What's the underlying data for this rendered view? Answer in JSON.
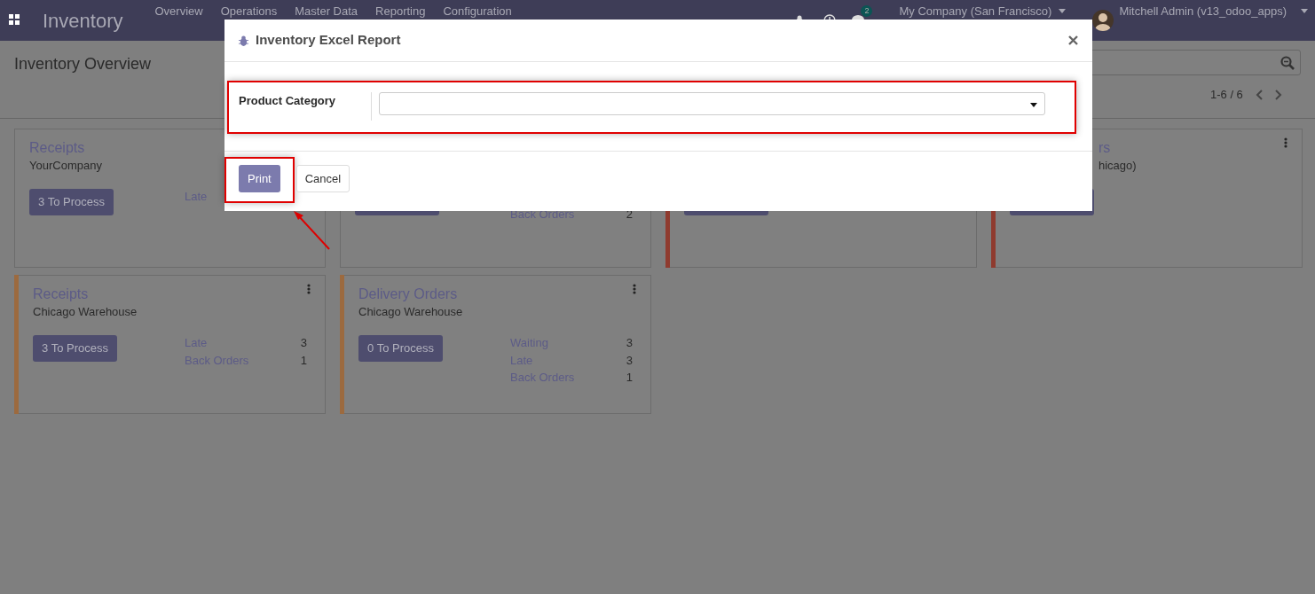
{
  "navbar": {
    "app_title": "Inventory",
    "menu": [
      {
        "label": "Overview"
      },
      {
        "label": "Operations"
      },
      {
        "label": "Master Data"
      },
      {
        "label": "Reporting"
      },
      {
        "label": "Configuration"
      }
    ],
    "message_count": "2",
    "company": "My Company (San Francisco)",
    "user": "Mitchell Admin (v13_odoo_apps)"
  },
  "control_panel": {
    "breadcrumb": "Inventory Overview",
    "pager": "1-6 / 6"
  },
  "cards": [
    {
      "title": "Receipts",
      "subtitle": "YourCompany",
      "button": "3 To Process",
      "stats": [
        {
          "label": "Late"
        }
      ]
    },
    {
      "stats": [
        {
          "label": "Back Orders",
          "count": "2"
        }
      ]
    },
    {
      "color": "#8f3b2f"
    },
    {
      "title": "rs",
      "subtitle": "hicago)",
      "menu": true,
      "color": "#8f3b2f"
    },
    {
      "title": "Receipts",
      "subtitle": "Chicago Warehouse",
      "button": "3 To Process",
      "menu": true,
      "color": "#9c6a3f",
      "stats": [
        {
          "label": "Late",
          "count": "3"
        },
        {
          "label": "Back Orders",
          "count": "1"
        }
      ]
    },
    {
      "title": "Delivery Orders",
      "subtitle": "Chicago Warehouse",
      "button": "0 To Process",
      "menu": true,
      "color": "#9c6a3f",
      "stats": [
        {
          "label": "Waiting",
          "count": "3"
        },
        {
          "label": "Late",
          "count": "3"
        },
        {
          "label": "Back Orders",
          "count": "1"
        }
      ]
    }
  ],
  "dialog": {
    "title": "Inventory Excel Report",
    "fields": [
      {
        "label": "Product Category"
      }
    ],
    "buttons": [
      {
        "label": "Print",
        "kind": "primary"
      },
      {
        "label": "Cancel",
        "kind": "secondary"
      }
    ]
  }
}
